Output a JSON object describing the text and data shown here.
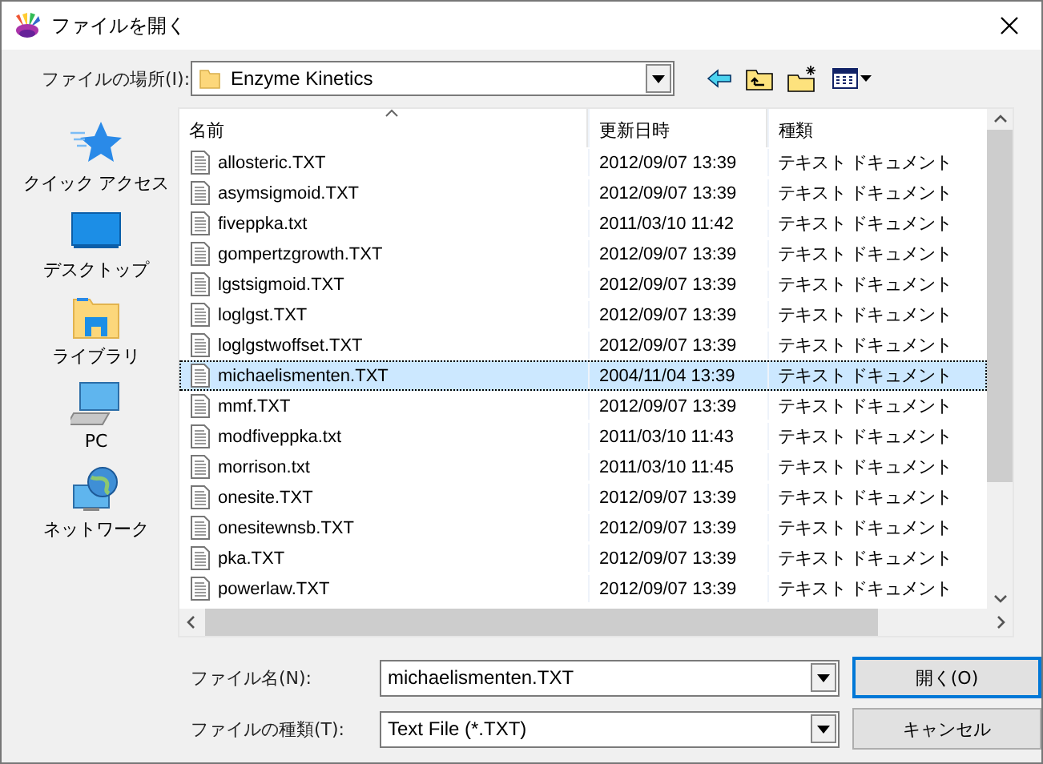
{
  "window": {
    "title": "ファイルを開く"
  },
  "location": {
    "label": "ファイルの場所(I):",
    "value": "Enzyme Kinetics"
  },
  "sidebar": {
    "items": [
      {
        "label": "クイック アクセス",
        "kind": "star"
      },
      {
        "label": "デスクトップ",
        "kind": "desktop"
      },
      {
        "label": "ライブラリ",
        "kind": "library"
      },
      {
        "label": "PC",
        "kind": "pc"
      },
      {
        "label": "ネットワーク",
        "kind": "network"
      }
    ]
  },
  "table": {
    "columns": [
      "名前",
      "更新日時",
      "種類"
    ],
    "rows": [
      {
        "name": "allosteric.TXT",
        "date": "2012/09/07 13:39",
        "type": "テキスト ドキュメント",
        "selected": false
      },
      {
        "name": "asymsigmoid.TXT",
        "date": "2012/09/07 13:39",
        "type": "テキスト ドキュメント",
        "selected": false
      },
      {
        "name": "fiveppka.txt",
        "date": "2011/03/10 11:42",
        "type": "テキスト ドキュメント",
        "selected": false
      },
      {
        "name": "gompertzgrowth.TXT",
        "date": "2012/09/07 13:39",
        "type": "テキスト ドキュメント",
        "selected": false
      },
      {
        "name": "lgstsigmoid.TXT",
        "date": "2012/09/07 13:39",
        "type": "テキスト ドキュメント",
        "selected": false
      },
      {
        "name": "loglgst.TXT",
        "date": "2012/09/07 13:39",
        "type": "テキスト ドキュメント",
        "selected": false
      },
      {
        "name": "loglgstwoffset.TXT",
        "date": "2012/09/07 13:39",
        "type": "テキスト ドキュメント",
        "selected": false
      },
      {
        "name": "michaelismenten.TXT",
        "date": "2004/11/04 13:39",
        "type": "テキスト ドキュメント",
        "selected": true
      },
      {
        "name": "mmf.TXT",
        "date": "2012/09/07 13:39",
        "type": "テキスト ドキュメント",
        "selected": false
      },
      {
        "name": "modfiveppka.txt",
        "date": "2011/03/10 11:43",
        "type": "テキスト ドキュメント",
        "selected": false
      },
      {
        "name": "morrison.txt",
        "date": "2011/03/10 11:45",
        "type": "テキスト ドキュメント",
        "selected": false
      },
      {
        "name": "onesite.TXT",
        "date": "2012/09/07 13:39",
        "type": "テキスト ドキュメント",
        "selected": false
      },
      {
        "name": "onesitewnsb.TXT",
        "date": "2012/09/07 13:39",
        "type": "テキスト ドキュメント",
        "selected": false
      },
      {
        "name": "pka.TXT",
        "date": "2012/09/07 13:39",
        "type": "テキスト ドキュメント",
        "selected": false
      },
      {
        "name": "powerlaw.TXT",
        "date": "2012/09/07 13:39",
        "type": "テキスト ドキュメント",
        "selected": false
      }
    ]
  },
  "filename": {
    "label": "ファイル名(N):",
    "value": "michaelismenten.TXT"
  },
  "filetype": {
    "label": "ファイルの種類(T):",
    "value": "Text File (*.TXT)"
  },
  "buttons": [
    "開く(O)",
    "キャンセル"
  ]
}
